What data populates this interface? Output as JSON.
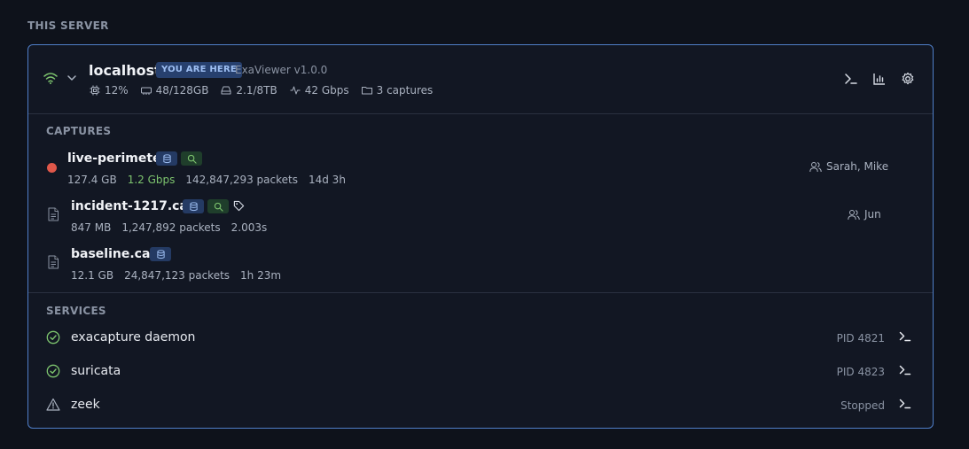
{
  "section_title": "THIS SERVER",
  "host": {
    "name": "localhost",
    "badge": "YOU ARE HERE",
    "version": "ExaViewer v1.0.0",
    "stats": {
      "cpu": "12%",
      "memory": "48/128GB",
      "disk": "2.1/8TB",
      "network": "42 Gbps",
      "captures": "3 captures"
    }
  },
  "captures_label": "CAPTURES",
  "captures": [
    {
      "name": "live-perimeter",
      "status": "recording",
      "size": "127.4 GB",
      "rate": "1.2 Gbps",
      "packets": "142,847,293 packets",
      "duration": "14d 3h",
      "users": "Sarah, Mike",
      "tags": [
        "database-icon",
        "search-icon"
      ]
    },
    {
      "name": "incident-1217.cap",
      "status": "file",
      "size": "847 MB",
      "packets": "1,247,892 packets",
      "duration": "2.003s",
      "users": "Jun",
      "tags": [
        "database-icon",
        "search-icon",
        "tag-icon"
      ]
    },
    {
      "name": "baseline.cap",
      "status": "file",
      "size": "12.1 GB",
      "packets": "24,847,123 packets",
      "duration": "1h 23m",
      "tags": [
        "database-icon"
      ]
    }
  ],
  "services_label": "SERVICES",
  "services": [
    {
      "name": "exacapture daemon",
      "status": "running",
      "detail": "PID 4821"
    },
    {
      "name": "suricata",
      "status": "running",
      "detail": "PID 4823"
    },
    {
      "name": "zeek",
      "status": "warning",
      "detail": "Stopped"
    }
  ],
  "colors": {
    "accent": "#4f7ec8",
    "ok": "#7dc46e",
    "recording": "#e0584a",
    "background": "#0e121b"
  }
}
